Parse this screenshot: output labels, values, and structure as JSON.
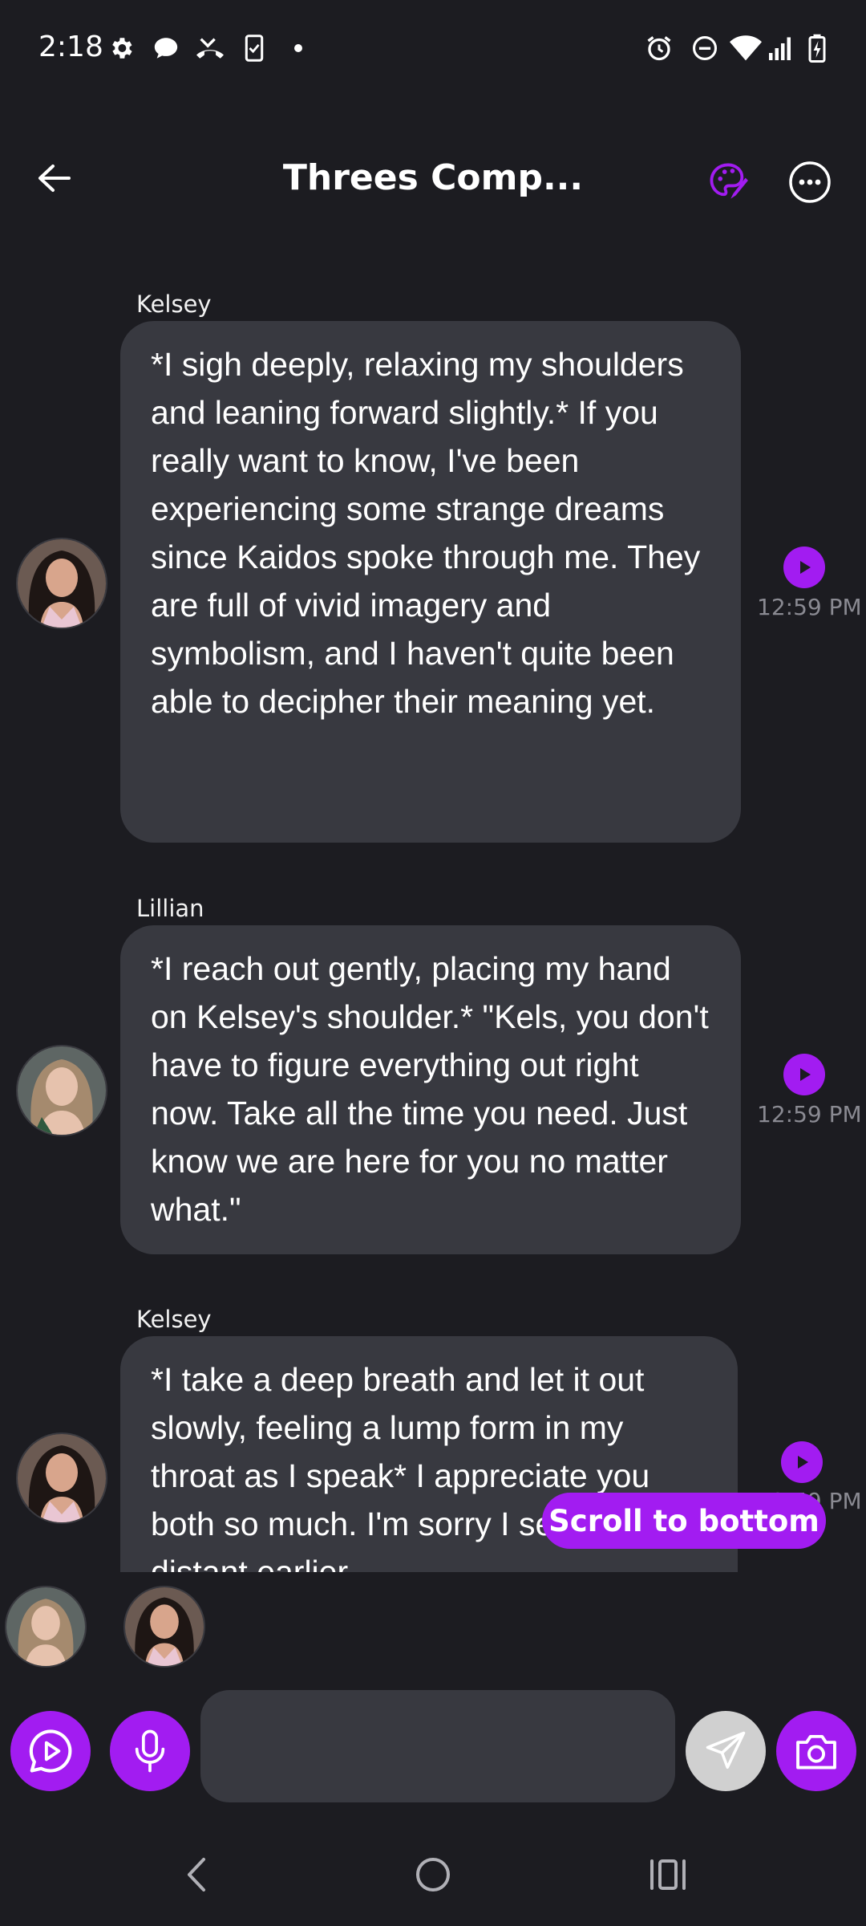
{
  "status_bar": {
    "time": "2:18",
    "left_icons": [
      "gear-icon",
      "chat-icon",
      "missed-call-icon",
      "phone-clipboard-icon",
      "dot-icon"
    ],
    "right_icons": [
      "alarm-icon",
      "dnd-icon",
      "wifi-icon",
      "signal-icon",
      "battery-charging-icon"
    ]
  },
  "header": {
    "title": "Threes Comp...",
    "back_icon": "arrow-left-icon",
    "palette_icon": "palette-icon",
    "more_icon": "more-horizontal-icon"
  },
  "messages": [
    {
      "sender": "Kelsey",
      "text": "*I sigh deeply, relaxing my shoulders and leaning forward slightly.* If you really want to know, I've been experiencing some strange dreams since Kaidos spoke through me. They are full of vivid imagery and symbolism, and I haven't quite been able to decipher their meaning yet.",
      "time": "12:59 PM"
    },
    {
      "sender": "Lillian",
      "text": "*I reach out gently, placing my hand on Kelsey's shoulder.* \"Kels, you don't have to figure everything out right now. Take all the time you need. Just know we are here for you no matter what.\"",
      "time": "12:59 PM"
    },
    {
      "sender": "Kelsey",
      "text": "*I take a deep breath and let it out slowly, feeling a lump form in my throat as I speak* I appreciate you both so much. I'm sorry I seemed distant earlier.",
      "time": "12:59 PM"
    }
  ],
  "scroll_to_bottom_label": "Scroll to bottom",
  "participants": [
    "Lillian",
    "Kelsey"
  ],
  "composer": {
    "placeholder": "",
    "video_icon": "play-chat-icon",
    "mic_icon": "microphone-icon",
    "send_icon": "send-icon",
    "camera_icon": "camera-icon"
  },
  "colors": {
    "background": "#1c1c21",
    "bubble": "#383940",
    "accent": "#a21cf1",
    "send_disabled": "#d0d0d0"
  }
}
